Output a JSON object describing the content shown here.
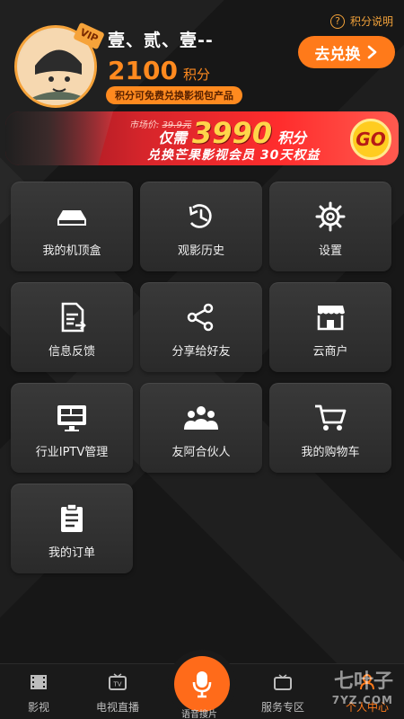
{
  "header": {
    "user_name": "壹、贰、壹--",
    "points_value": "2100",
    "points_unit": "积分",
    "points_tip": "积分可免费兑换影视包产品",
    "points_rules": "积分说明",
    "exchange_button": "去兑换",
    "vip_badge": "VIP"
  },
  "banner": {
    "market_label": "市场价:",
    "market_price": "39.9元",
    "only": "仅需",
    "points_number": "3990",
    "points_unit": "积分",
    "subtitle": "兑换芒果影视会员 30天权益",
    "go": "GO"
  },
  "grid": [
    {
      "label": "我的机顶盒",
      "icon": "settop-box-icon"
    },
    {
      "label": "观影历史",
      "icon": "history-icon"
    },
    {
      "label": "设置",
      "icon": "gear-icon"
    },
    {
      "label": "信息反馈",
      "icon": "feedback-icon"
    },
    {
      "label": "分享给好友",
      "icon": "share-icon"
    },
    {
      "label": "云商户",
      "icon": "store-icon"
    },
    {
      "label": "行业IPTV管理",
      "icon": "monitor-icon"
    },
    {
      "label": "友阿合伙人",
      "icon": "partner-icon"
    },
    {
      "label": "我的购物车",
      "icon": "cart-icon"
    },
    {
      "label": "我的订单",
      "icon": "clipboard-icon"
    }
  ],
  "tabbar": {
    "tab1": "影视",
    "tab2": "电视直播",
    "voice": "语音搜片",
    "tab4": "服务专区",
    "tab5": "个人中心"
  },
  "watermark": {
    "main": "七叶子",
    "sub": "7YZ.COM"
  },
  "colors": {
    "accent": "#ff7a1a",
    "background": "#171717"
  }
}
